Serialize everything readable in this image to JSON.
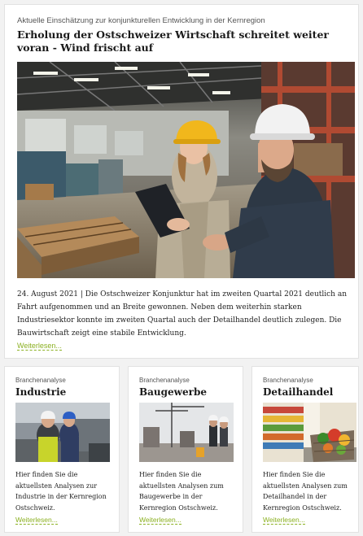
{
  "hero": {
    "kicker": "Aktuelle Einschätzung zur konjunkturellen Entwicklung in der Kernregion",
    "title": "Erholung der Ostschweizer Wirtschaft schreitet weiter voran - Wind frischt auf",
    "date": "24. August 2021",
    "separator": " | ",
    "body": "Die Ostschweizer Konjunktur hat im zweiten Quartal 2021 deutlich an Fahrt aufgenommen und an Breite gewonnen. Neben dem weiterhin starken Industriesektor konnte im zweiten Quartal auch der Detailhandel deutlich zulegen. Die Bauwirtschaft zeigt eine stabile Entwicklung.",
    "more_label": "Weiterlesen..."
  },
  "cards": [
    {
      "kicker": "Branchenanalyse",
      "title": "Industrie",
      "text": "Hier finden Sie die aktuellsten Analysen zur Industrie in der Kernregion Ostschweiz.",
      "more_label": "Weiterlesen..."
    },
    {
      "kicker": "Branchenanalyse",
      "title": "Baugewerbe",
      "text": "Hier finden Sie die aktuellsten Analysen zum Baugewerbe in der Kernregion Ostschweiz.",
      "more_label": "Weiterlesen..."
    },
    {
      "kicker": "Branchenanalyse",
      "title": "Detailhandel",
      "text": "Hier finden Sie die aktuellsten Analysen zum Detailhandel in der Kernregion Ostschweiz.",
      "more_label": "Weiterlesen..."
    }
  ],
  "colors": {
    "link": "#8bb021",
    "helmet_yellow": "#f1b71c",
    "helmet_white": "#f2f2f2"
  }
}
